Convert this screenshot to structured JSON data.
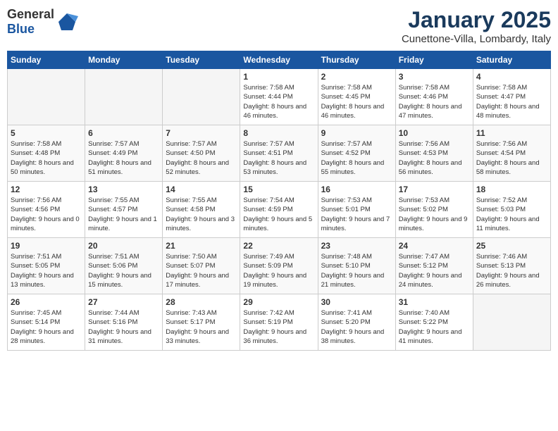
{
  "header": {
    "logo_general": "General",
    "logo_blue": "Blue",
    "month": "January 2025",
    "location": "Cunettone-Villa, Lombardy, Italy"
  },
  "weekdays": [
    "Sunday",
    "Monday",
    "Tuesday",
    "Wednesday",
    "Thursday",
    "Friday",
    "Saturday"
  ],
  "weeks": [
    [
      {
        "day": "",
        "sunrise": "",
        "sunset": "",
        "daylight": ""
      },
      {
        "day": "",
        "sunrise": "",
        "sunset": "",
        "daylight": ""
      },
      {
        "day": "",
        "sunrise": "",
        "sunset": "",
        "daylight": ""
      },
      {
        "day": "1",
        "sunrise": "Sunrise: 7:58 AM",
        "sunset": "Sunset: 4:44 PM",
        "daylight": "Daylight: 8 hours and 46 minutes."
      },
      {
        "day": "2",
        "sunrise": "Sunrise: 7:58 AM",
        "sunset": "Sunset: 4:45 PM",
        "daylight": "Daylight: 8 hours and 46 minutes."
      },
      {
        "day": "3",
        "sunrise": "Sunrise: 7:58 AM",
        "sunset": "Sunset: 4:46 PM",
        "daylight": "Daylight: 8 hours and 47 minutes."
      },
      {
        "day": "4",
        "sunrise": "Sunrise: 7:58 AM",
        "sunset": "Sunset: 4:47 PM",
        "daylight": "Daylight: 8 hours and 48 minutes."
      }
    ],
    [
      {
        "day": "5",
        "sunrise": "Sunrise: 7:58 AM",
        "sunset": "Sunset: 4:48 PM",
        "daylight": "Daylight: 8 hours and 50 minutes."
      },
      {
        "day": "6",
        "sunrise": "Sunrise: 7:57 AM",
        "sunset": "Sunset: 4:49 PM",
        "daylight": "Daylight: 8 hours and 51 minutes."
      },
      {
        "day": "7",
        "sunrise": "Sunrise: 7:57 AM",
        "sunset": "Sunset: 4:50 PM",
        "daylight": "Daylight: 8 hours and 52 minutes."
      },
      {
        "day": "8",
        "sunrise": "Sunrise: 7:57 AM",
        "sunset": "Sunset: 4:51 PM",
        "daylight": "Daylight: 8 hours and 53 minutes."
      },
      {
        "day": "9",
        "sunrise": "Sunrise: 7:57 AM",
        "sunset": "Sunset: 4:52 PM",
        "daylight": "Daylight: 8 hours and 55 minutes."
      },
      {
        "day": "10",
        "sunrise": "Sunrise: 7:56 AM",
        "sunset": "Sunset: 4:53 PM",
        "daylight": "Daylight: 8 hours and 56 minutes."
      },
      {
        "day": "11",
        "sunrise": "Sunrise: 7:56 AM",
        "sunset": "Sunset: 4:54 PM",
        "daylight": "Daylight: 8 hours and 58 minutes."
      }
    ],
    [
      {
        "day": "12",
        "sunrise": "Sunrise: 7:56 AM",
        "sunset": "Sunset: 4:56 PM",
        "daylight": "Daylight: 9 hours and 0 minutes."
      },
      {
        "day": "13",
        "sunrise": "Sunrise: 7:55 AM",
        "sunset": "Sunset: 4:57 PM",
        "daylight": "Daylight: 9 hours and 1 minute."
      },
      {
        "day": "14",
        "sunrise": "Sunrise: 7:55 AM",
        "sunset": "Sunset: 4:58 PM",
        "daylight": "Daylight: 9 hours and 3 minutes."
      },
      {
        "day": "15",
        "sunrise": "Sunrise: 7:54 AM",
        "sunset": "Sunset: 4:59 PM",
        "daylight": "Daylight: 9 hours and 5 minutes."
      },
      {
        "day": "16",
        "sunrise": "Sunrise: 7:53 AM",
        "sunset": "Sunset: 5:01 PM",
        "daylight": "Daylight: 9 hours and 7 minutes."
      },
      {
        "day": "17",
        "sunrise": "Sunrise: 7:53 AM",
        "sunset": "Sunset: 5:02 PM",
        "daylight": "Daylight: 9 hours and 9 minutes."
      },
      {
        "day": "18",
        "sunrise": "Sunrise: 7:52 AM",
        "sunset": "Sunset: 5:03 PM",
        "daylight": "Daylight: 9 hours and 11 minutes."
      }
    ],
    [
      {
        "day": "19",
        "sunrise": "Sunrise: 7:51 AM",
        "sunset": "Sunset: 5:05 PM",
        "daylight": "Daylight: 9 hours and 13 minutes."
      },
      {
        "day": "20",
        "sunrise": "Sunrise: 7:51 AM",
        "sunset": "Sunset: 5:06 PM",
        "daylight": "Daylight: 9 hours and 15 minutes."
      },
      {
        "day": "21",
        "sunrise": "Sunrise: 7:50 AM",
        "sunset": "Sunset: 5:07 PM",
        "daylight": "Daylight: 9 hours and 17 minutes."
      },
      {
        "day": "22",
        "sunrise": "Sunrise: 7:49 AM",
        "sunset": "Sunset: 5:09 PM",
        "daylight": "Daylight: 9 hours and 19 minutes."
      },
      {
        "day": "23",
        "sunrise": "Sunrise: 7:48 AM",
        "sunset": "Sunset: 5:10 PM",
        "daylight": "Daylight: 9 hours and 21 minutes."
      },
      {
        "day": "24",
        "sunrise": "Sunrise: 7:47 AM",
        "sunset": "Sunset: 5:12 PM",
        "daylight": "Daylight: 9 hours and 24 minutes."
      },
      {
        "day": "25",
        "sunrise": "Sunrise: 7:46 AM",
        "sunset": "Sunset: 5:13 PM",
        "daylight": "Daylight: 9 hours and 26 minutes."
      }
    ],
    [
      {
        "day": "26",
        "sunrise": "Sunrise: 7:45 AM",
        "sunset": "Sunset: 5:14 PM",
        "daylight": "Daylight: 9 hours and 28 minutes."
      },
      {
        "day": "27",
        "sunrise": "Sunrise: 7:44 AM",
        "sunset": "Sunset: 5:16 PM",
        "daylight": "Daylight: 9 hours and 31 minutes."
      },
      {
        "day": "28",
        "sunrise": "Sunrise: 7:43 AM",
        "sunset": "Sunset: 5:17 PM",
        "daylight": "Daylight: 9 hours and 33 minutes."
      },
      {
        "day": "29",
        "sunrise": "Sunrise: 7:42 AM",
        "sunset": "Sunset: 5:19 PM",
        "daylight": "Daylight: 9 hours and 36 minutes."
      },
      {
        "day": "30",
        "sunrise": "Sunrise: 7:41 AM",
        "sunset": "Sunset: 5:20 PM",
        "daylight": "Daylight: 9 hours and 38 minutes."
      },
      {
        "day": "31",
        "sunrise": "Sunrise: 7:40 AM",
        "sunset": "Sunset: 5:22 PM",
        "daylight": "Daylight: 9 hours and 41 minutes."
      },
      {
        "day": "",
        "sunrise": "",
        "sunset": "",
        "daylight": ""
      }
    ]
  ]
}
